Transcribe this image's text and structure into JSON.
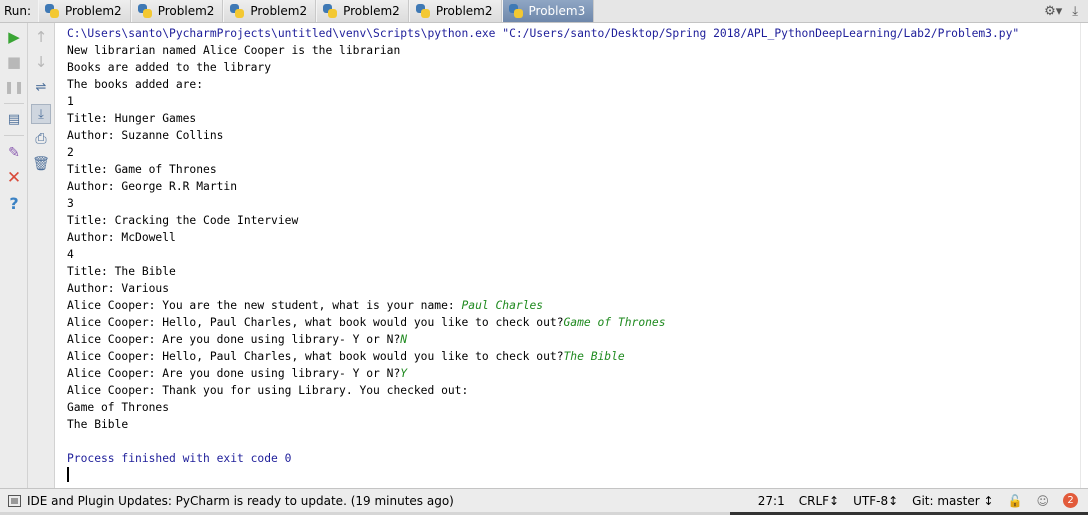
{
  "run_label": "Run:",
  "tabs": [
    {
      "label": "Problem2",
      "active": false
    },
    {
      "label": "Problem2",
      "active": false
    },
    {
      "label": "Problem2",
      "active": false
    },
    {
      "label": "Problem2",
      "active": false
    },
    {
      "label": "Problem2",
      "active": false
    },
    {
      "label": "Problem3",
      "active": true
    }
  ],
  "top_right": {
    "settings_icon": "gear-icon",
    "minimize_icon": "minimize-icon",
    "hide_icon": "hide-icon"
  },
  "console": {
    "command": "C:\\Users\\santo\\PycharmProjects\\untitled\\venv\\Scripts\\python.exe \"C:/Users/santo/Desktop/Spring 2018/APL_PythonDeepLearning/Lab2/Problem3.py\"",
    "lines": [
      "New librarian named Alice Cooper is the librarian",
      "Books are added to the library",
      "The books added are:",
      "1",
      "Title: Hunger Games",
      "Author: Suzanne Collins",
      "2",
      "Title: Game of Thrones",
      "Author: George R.R Martin",
      "3",
      "Title: Cracking the Code Interview",
      "Author: McDowell",
      "4",
      "Title: The Bible",
      "Author: Various"
    ],
    "dialog": [
      {
        "prompt": "Alice Cooper: You are the new student, what is your name: ",
        "input": "Paul Charles"
      },
      {
        "prompt": "Alice Cooper: Hello, Paul Charles, what book would you like to check out?",
        "input": "Game of Thrones"
      },
      {
        "prompt": "Alice Cooper: Are you done using library- Y or N?",
        "input": "N"
      },
      {
        "prompt": "Alice Cooper: Hello, Paul Charles, what book would you like to check out?",
        "input": "The Bible"
      },
      {
        "prompt": "Alice Cooper: Are you done using library- Y or N?",
        "input": "Y"
      }
    ],
    "tail": [
      "Alice Cooper: Thank you for using Library. You checked out:",
      "Game of Thrones",
      "The Bible",
      ""
    ],
    "exit": "Process finished with exit code 0"
  },
  "status": {
    "message": "IDE and Plugin Updates: PyCharm is ready to update. (19 minutes ago)",
    "position": "27:1",
    "line_sep": "CRLF↕",
    "encoding": "UTF-8↕",
    "git": "Git: master ↕",
    "notifications": "2"
  },
  "colors": {
    "input": "#1f8a1f",
    "command": "#1e1e9a",
    "active_tab": "#7b93b6",
    "run_green": "#3aa535",
    "stop_red": "#d94a3a"
  }
}
